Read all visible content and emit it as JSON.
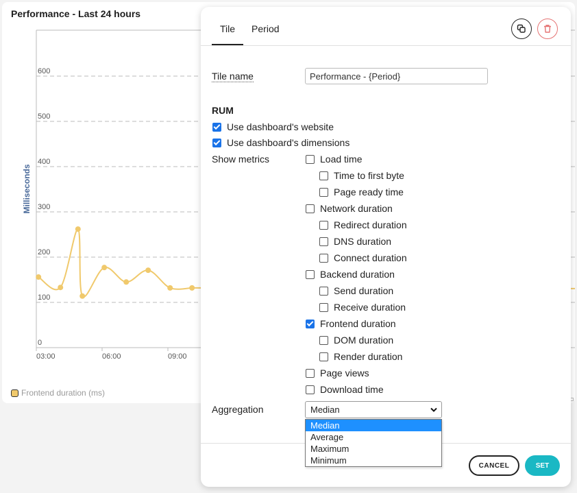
{
  "tile": {
    "title": "Performance - Last 24 hours",
    "legend_label": "Frontend duration (ms)",
    "legend_color": "#f0c96c"
  },
  "chart_data": {
    "type": "line",
    "title": "Performance - Last 24 hours",
    "xlabel": "",
    "ylabel": "Milliseconds",
    "ylim": [
      0,
      700
    ],
    "yticks": [
      0,
      100,
      200,
      300,
      400,
      500,
      600
    ],
    "xticks": [
      "03:00",
      "06:00",
      "09:00"
    ],
    "grid": true,
    "legend_position": "bottom-left",
    "series": [
      {
        "name": "Frontend duration (ms)",
        "color": "#f0c96c",
        "x_hours": [
          3.1,
          4.1,
          4.9,
          5.1,
          6.1,
          7.1,
          8.1,
          9.1,
          10.1
        ],
        "values": [
          156,
          133,
          262,
          114,
          177,
          145,
          171,
          132,
          132
        ]
      }
    ]
  },
  "panel": {
    "tabs": [
      {
        "label": "Tile",
        "active": true
      },
      {
        "label": "Period",
        "active": false
      }
    ],
    "copy_icon": "copy-icon",
    "delete_icon": "trash-icon",
    "tile_name_label": "Tile name",
    "tile_name_value": "Performance - {Period}",
    "section_heading": "RUM",
    "use_website_label": "Use dashboard's website",
    "use_website_checked": true,
    "use_dimensions_label": "Use dashboard's dimensions",
    "use_dimensions_checked": true,
    "show_metrics_label": "Show metrics",
    "metrics": [
      {
        "label": "Load time",
        "checked": false,
        "level": 0
      },
      {
        "label": "Time to first byte",
        "checked": false,
        "level": 1
      },
      {
        "label": "Page ready time",
        "checked": false,
        "level": 1
      },
      {
        "label": "Network duration",
        "checked": false,
        "level": 0
      },
      {
        "label": "Redirect duration",
        "checked": false,
        "level": 1
      },
      {
        "label": "DNS duration",
        "checked": false,
        "level": 1
      },
      {
        "label": "Connect duration",
        "checked": false,
        "level": 1
      },
      {
        "label": "Backend duration",
        "checked": false,
        "level": 0
      },
      {
        "label": "Send duration",
        "checked": false,
        "level": 1
      },
      {
        "label": "Receive duration",
        "checked": false,
        "level": 1
      },
      {
        "label": "Frontend duration",
        "checked": true,
        "level": 0
      },
      {
        "label": "DOM duration",
        "checked": false,
        "level": 1
      },
      {
        "label": "Render duration",
        "checked": false,
        "level": 1
      },
      {
        "label": "Page views",
        "checked": false,
        "level": 0
      },
      {
        "label": "Download time",
        "checked": false,
        "level": 0
      }
    ],
    "aggregation_label": "Aggregation",
    "aggregation_value": "Median",
    "aggregation_options": [
      "Median",
      "Average",
      "Maximum",
      "Minimum"
    ],
    "cancel_label": "CANCEL",
    "set_label": "SET",
    "accent_color": "#1ab8c4"
  }
}
